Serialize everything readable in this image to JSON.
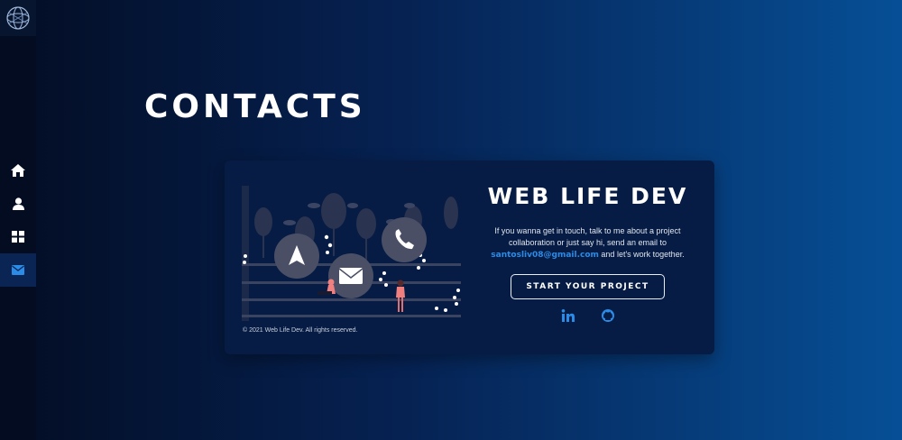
{
  "sidebar": {
    "logo_icon": "globe-logo-icon",
    "items": [
      {
        "icon": "home-icon",
        "active": false
      },
      {
        "icon": "user-icon",
        "active": false
      },
      {
        "icon": "grid-icon",
        "active": false
      },
      {
        "icon": "mail-icon",
        "active": true
      }
    ]
  },
  "page": {
    "title": "CONTACTS"
  },
  "card": {
    "brand": "WEB LIFE DEV",
    "blurb_before": "If you wanna get in touch, talk to me about a project collaboration or just say hi, send an email to",
    "email": "santosliv08@gmail.com",
    "blurb_after": " and let's work together.",
    "cta_label": "START YOUR PROJECT",
    "copyright": "© 2021 Web Life Dev. All rights reserved.",
    "social": [
      {
        "icon": "linkedin-icon"
      },
      {
        "icon": "github-icon"
      }
    ]
  },
  "colors": {
    "accent": "#2b8ce8",
    "card_bg": "#061c44",
    "sidebar_bg": "#030c20"
  }
}
